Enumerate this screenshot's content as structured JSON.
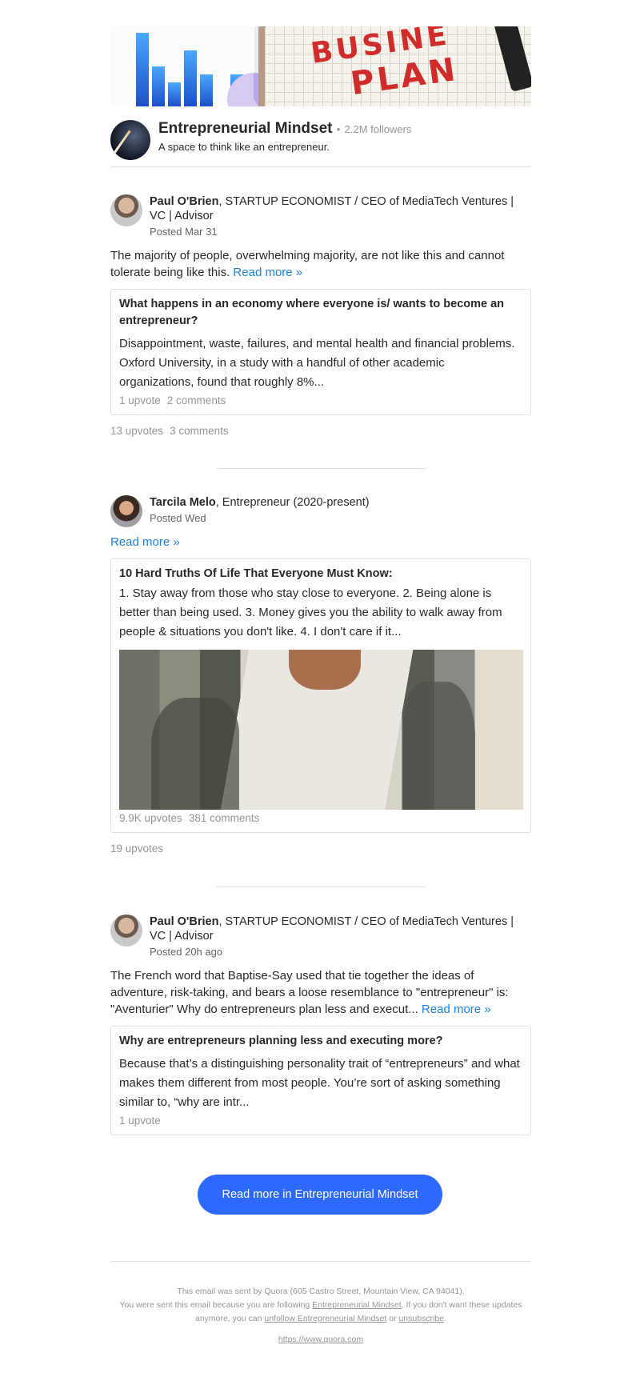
{
  "space": {
    "name": "Entrepreneurial Mindset",
    "dot": "•",
    "followers": "2.2M followers",
    "description": "A space to think like an entrepreneur.",
    "banner_text_1": "BUSINE",
    "banner_text_2": "PLAN"
  },
  "posts": [
    {
      "author_name": "Paul O'Brien",
      "author_cred": ", STARTUP ECONOMIST / CEO of MediaTech Ventures | VC | Advisor",
      "posted": "Posted Mar 31",
      "text": "The majority of people, overwhelming majority, are not like this and cannot tolerate being like this. ",
      "read_more": "Read more »",
      "card": {
        "question": "What happens in an economy where everyone is/ wants to become an entrepreneur?",
        "body": "Disappointment, waste, failures, and mental health and financial problems. Oxford University, in a study with a handful of other academic organizations, found that roughly 8%...",
        "upvotes": "1 upvote",
        "comments": "2 comments"
      },
      "upvotes": "13 upvotes",
      "comments": "3 comments"
    },
    {
      "author_name": "Tarcila Melo",
      "author_cred": ", Entrepreneur (2020-present)",
      "posted": "Posted Wed",
      "read_more": "Read more »",
      "card": {
        "question": "10 Hard Truths Of Life That Everyone Must Know:",
        "body": "1. Stay away from those who stay close to everyone. 2. Being alone is better than being used. 3. Money gives you the ability to walk away from people & situations you don't like. 4. I don't care if it...",
        "upvotes": "9.9K upvotes",
        "comments": "381 comments"
      },
      "upvotes": "19 upvotes"
    },
    {
      "author_name": "Paul O'Brien",
      "author_cred": ", STARTUP ECONOMIST / CEO of MediaTech Ventures | VC | Advisor",
      "posted": "Posted 20h ago",
      "text": "The French word that Baptise-Say used that tie together the ideas of adventure, risk-taking, and bears a loose resemblance to \"entrepreneur\" is: \"Aventurier\" Why do entrepreneurs plan less and execut... ",
      "read_more": "Read more »",
      "card": {
        "question": "Why are entrepreneurs planning less and executing more?",
        "body": "Because that’s a distinguishing personality trait of “entrepreneurs” and what makes them different from most people. You’re sort of asking something similar to, “why are intr...",
        "upvotes": "1 upvote"
      }
    }
  ],
  "cta": "Read more in Entrepreneurial Mindset",
  "footer": {
    "line1": "This email was sent by Quora (605 Castro Street, Mountain View, CA 94041).",
    "line2_a": "You were sent this email because you are following ",
    "line2_link": "Entrepreneurial Mindset",
    "line2_b": ". If you don't want these updates anymore, you can ",
    "unfollow": "unfollow Entrepreneurial Mindset",
    "or": " or ",
    "unsubscribe": "unsubscribe",
    "period": ".",
    "site": "https://www.quora.com"
  },
  "colors": {
    "accent": "#2e69ff",
    "link": "#1f82d6",
    "muted": "#939598",
    "text": "#282829"
  }
}
